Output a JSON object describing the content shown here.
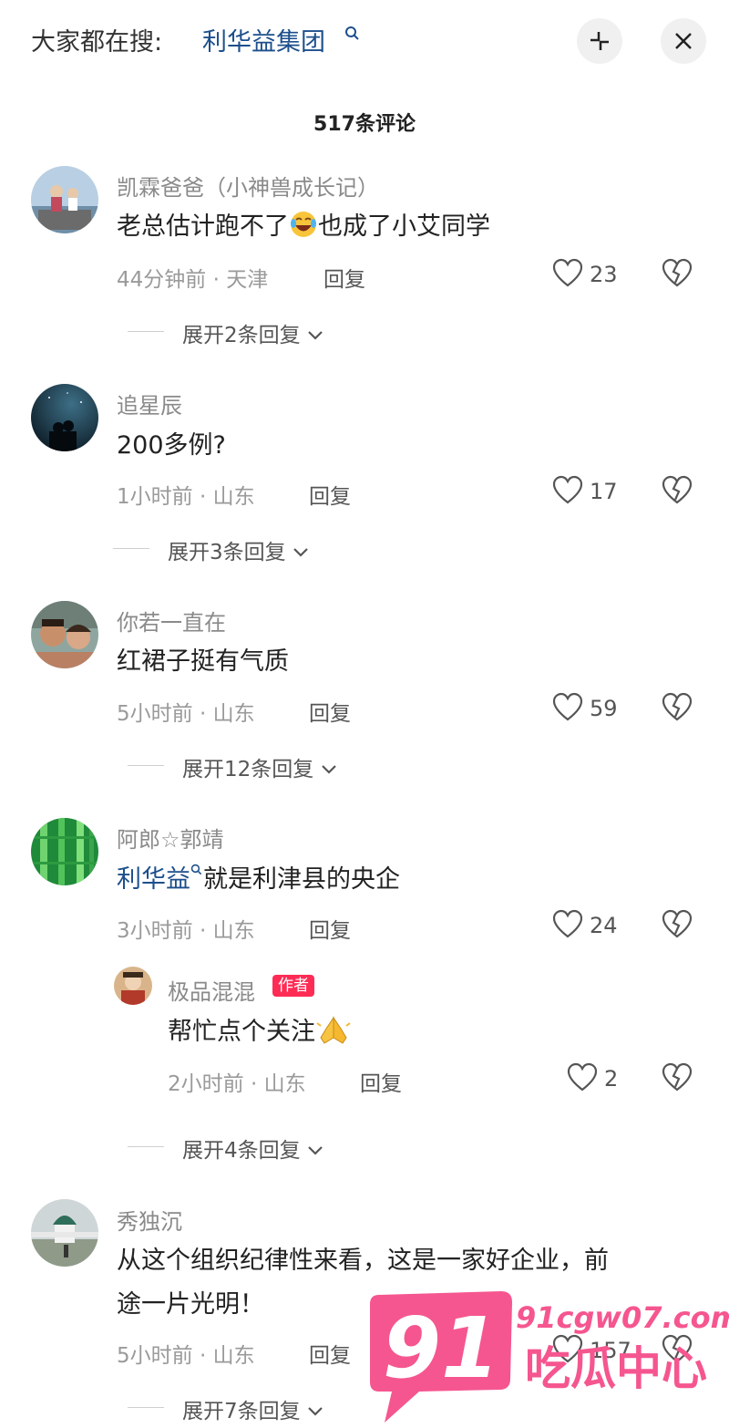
{
  "top": {
    "label": "大家都在搜:",
    "term": "利华益集团"
  },
  "comment_count": "517条评论",
  "comments": [
    {
      "user": "凯霖爸爸（小神兽成长记）",
      "text": "老总估计跑不了",
      "text2": "也成了小艾同学",
      "time": "44分钟前 · 天津",
      "reply": "回复",
      "likes": "23",
      "expand": "展开2条回复"
    },
    {
      "user": "追星辰",
      "text": "200多例?",
      "time": "1小时前 · 山东",
      "reply": "回复",
      "likes": "17",
      "expand": "展开3条回复"
    },
    {
      "user": "你若一直在",
      "text": "红裙子挺有气质",
      "time": "5小时前 · 山东",
      "reply": "回复",
      "likes": "59",
      "expand": "展开12条回复"
    },
    {
      "user": "阿郎☆郭靖",
      "link": "利华益",
      "text": "就是利津县的央企",
      "time": "3小时前 · 山东",
      "reply": "回复",
      "likes": "24",
      "sub": {
        "user": "极品混混",
        "badge": "作者",
        "text": "帮忙点个关注",
        "time": "2小时前 · 山东",
        "reply": "回复",
        "likes": "2"
      },
      "expand": "展开4条回复"
    },
    {
      "user": "秀独沉",
      "text_line1": "从这个组织纪律性来看，这是一家好企业，前",
      "text_line2": "途一片光明！",
      "time": "5小时前 · 山东",
      "reply": "回复",
      "likes": "157",
      "expand": "展开7条回复"
    }
  ],
  "watermark": {
    "number": "91",
    "domain": "91cgw07.com",
    "name": "吃瓜中心",
    "color": "#f5568f"
  }
}
